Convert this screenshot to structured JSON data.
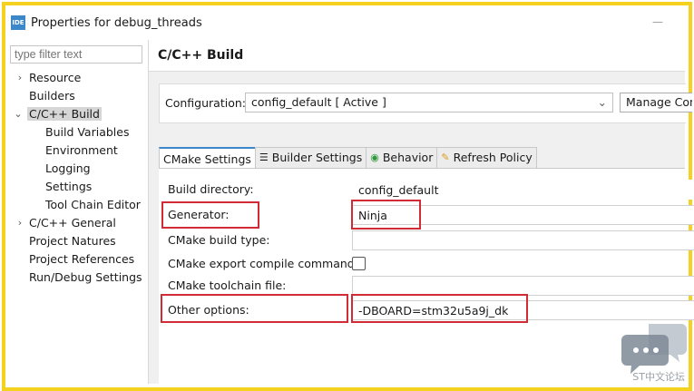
{
  "window": {
    "title": "Properties for debug_threads",
    "icon_label": "IDE"
  },
  "sidebar": {
    "filter_placeholder": "type filter text",
    "items": [
      {
        "label": "Resource",
        "expander": "›"
      },
      {
        "label": "Builders",
        "expander": ""
      },
      {
        "label": "C/C++ Build",
        "expander": "⌄"
      },
      {
        "label": "Build Variables",
        "expander": ""
      },
      {
        "label": "Environment",
        "expander": ""
      },
      {
        "label": "Logging",
        "expander": ""
      },
      {
        "label": "Settings",
        "expander": ""
      },
      {
        "label": "Tool Chain Editor",
        "expander": ""
      },
      {
        "label": "C/C++ General",
        "expander": "›"
      },
      {
        "label": "Project Natures",
        "expander": ""
      },
      {
        "label": "Project References",
        "expander": ""
      },
      {
        "label": "Run/Debug Settings",
        "expander": ""
      }
    ]
  },
  "main": {
    "page_title": "C/C++ Build",
    "configuration_label": "Configuration:",
    "configuration_value": "config_default  [ Active ]",
    "manage_button": "Manage Configurations...",
    "tabs": [
      {
        "label": "CMake Settings",
        "icon": ""
      },
      {
        "label": "Builder Settings",
        "icon": "☰"
      },
      {
        "label": "Behavior",
        "icon": "◉"
      },
      {
        "label": "Refresh Policy",
        "icon": "✎"
      }
    ],
    "fields": {
      "build_directory": {
        "label": "Build directory:",
        "value": "config_default"
      },
      "generator": {
        "label": "Generator:",
        "value": "Ninja"
      },
      "cmake_build_type": {
        "label": "CMake build type:",
        "value": ""
      },
      "export_compile_commands": {
        "label": "CMake export compile commands:",
        "checked": false
      },
      "toolchain_file": {
        "label": "CMake toolchain file:",
        "value": ""
      },
      "other_options": {
        "label": "Other options:",
        "value": "-DBOARD=stm32u5a9j_dk"
      }
    }
  },
  "watermark": {
    "text": "ST中文论坛",
    "icon": "chat-bubble-icon"
  },
  "colors": {
    "highlight": "#d12b36",
    "frame": "#f4d21f",
    "accent": "#3b87c9"
  }
}
